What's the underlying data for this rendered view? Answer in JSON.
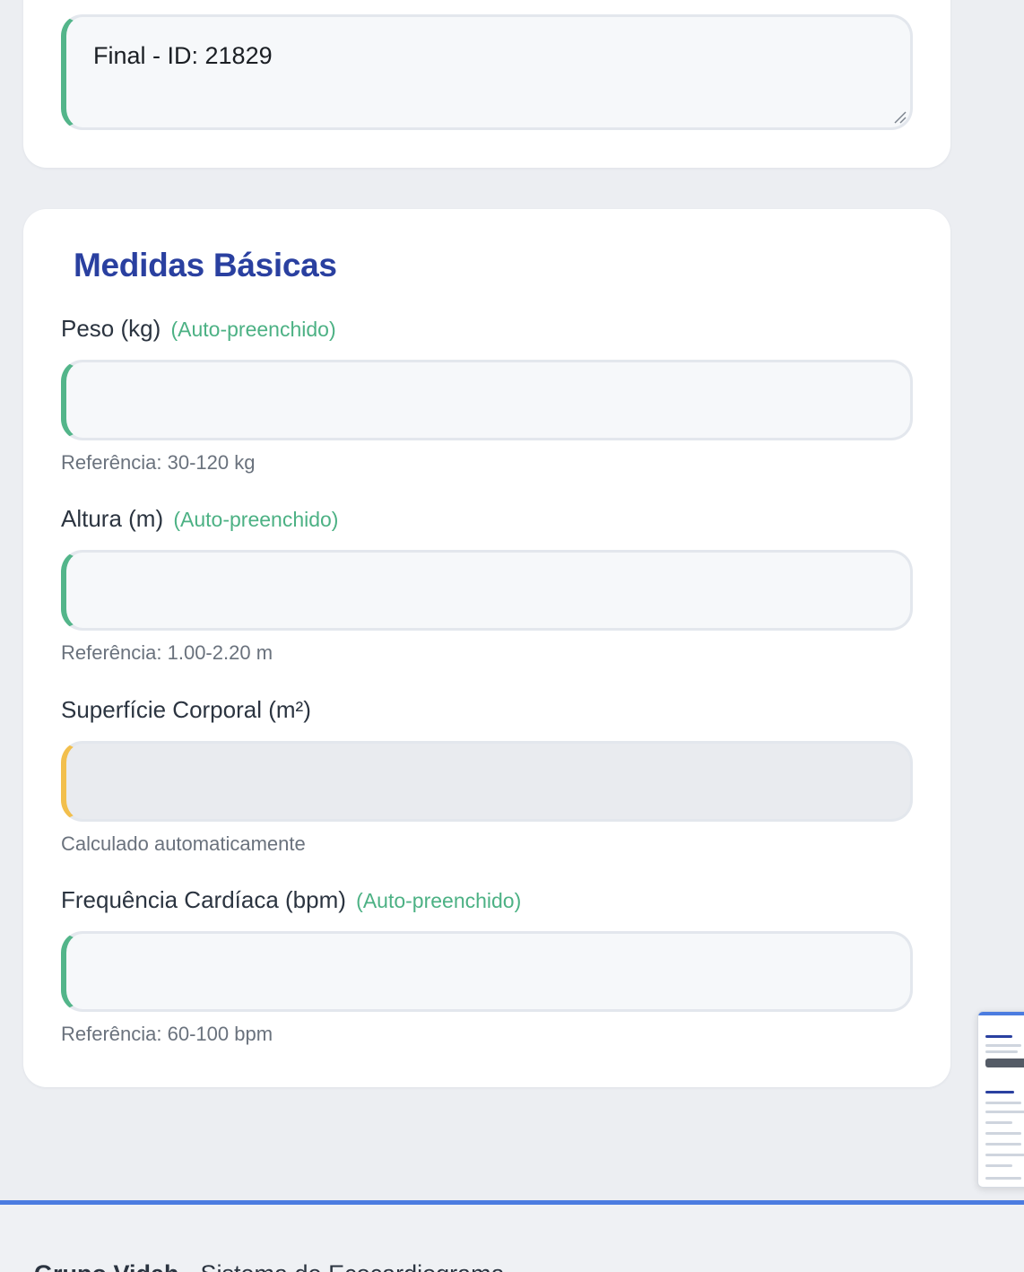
{
  "notes_field": {
    "value": "Final - ID: 21829"
  },
  "section": {
    "title": "Medidas Básicas",
    "fields": [
      {
        "label": "Peso (kg)",
        "tag": "(Auto-preenchido)",
        "value": "",
        "help": "Referência: 30-120 kg"
      },
      {
        "label": "Altura (m)",
        "tag": "(Auto-preenchido)",
        "value": "",
        "help": "Referência: 1.00-2.20 m"
      },
      {
        "label": "Superfície Corporal (m²)",
        "tag": "",
        "value": "",
        "help": "Calculado automaticamente"
      },
      {
        "label": "Frequência Cardíaca (bpm)",
        "tag": "(Auto-preenchido)",
        "value": "",
        "help": "Referência: 60-100 bpm"
      }
    ]
  },
  "footer": {
    "brand": "Grupo Vidah",
    "subtitle": " - Sistema de Ecocardiograma"
  },
  "colors": {
    "accent_green": "#53b58a",
    "accent_yellow": "#f2bf4d",
    "title_blue": "#2a40a0",
    "footer_blue": "#4b7ce0"
  }
}
